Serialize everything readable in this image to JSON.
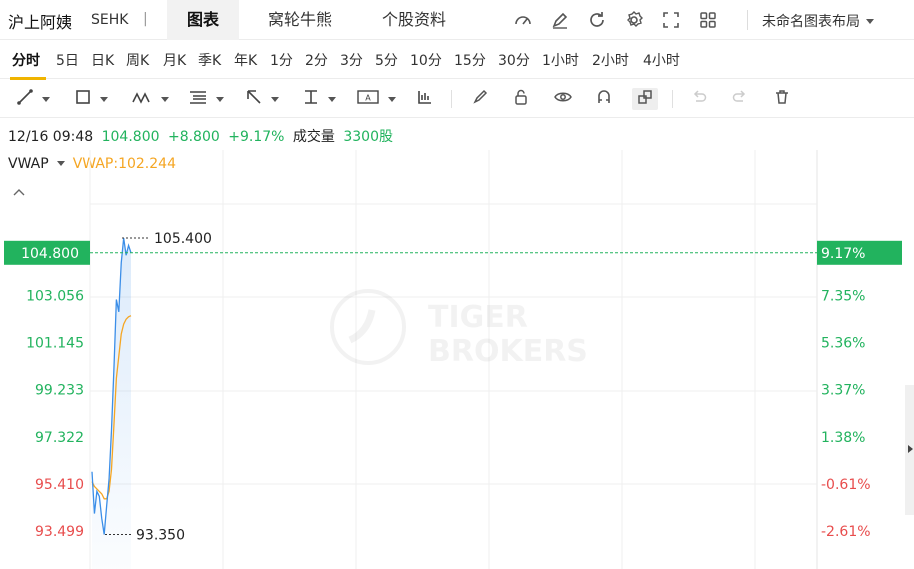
{
  "header": {
    "stock_name": "沪上阿姨",
    "stock_code": "SEHK",
    "separator": "|",
    "tabs": [
      {
        "label": "图表",
        "active": true
      },
      {
        "label": "窝轮牛熊",
        "active": false
      },
      {
        "label": "个股资料",
        "active": false
      }
    ],
    "icons": [
      "gauge-icon",
      "edit-icon",
      "refresh-icon",
      "settings-icon",
      "fullscreen-icon",
      "grid-icon"
    ],
    "layout_name": "未命名图表布局"
  },
  "periods": [
    "分时",
    "5日",
    "日K",
    "周K",
    "月K",
    "季K",
    "年K",
    "1分",
    "2分",
    "3分",
    "5分",
    "10分",
    "15分",
    "30分",
    "1小时",
    "2小时",
    "4小时"
  ],
  "active_period": "分时",
  "toolbar": {
    "tools": [
      "line-tool-icon",
      "rect-tool-icon",
      "wave-tool-icon",
      "fib-tool-icon",
      "arrow-tool-icon",
      "price-range-icon",
      "text-tool-icon",
      "indicator-icon",
      "brush-icon",
      "lock-icon",
      "eye-icon",
      "magnet-icon",
      "link-icon",
      "undo-icon",
      "redo-icon",
      "delete-icon"
    ]
  },
  "quote": {
    "datetime": "12/16 09:48",
    "price": "104.800",
    "change": "+8.800",
    "change_pct": "+9.17%",
    "volume_label": "成交量",
    "volume": "3300股"
  },
  "indicator": {
    "name": "VWAP",
    "value_label": "VWAP:102.244"
  },
  "chart_data": {
    "type": "line",
    "y_ticks": [
      "104.800",
      "103.056",
      "101.145",
      "99.233",
      "97.322",
      "95.410",
      "93.499"
    ],
    "y_tick_values": [
      104.8,
      103.056,
      101.145,
      99.233,
      97.322,
      95.41,
      93.499
    ],
    "pct_ticks": [
      "9.17%",
      "7.35%",
      "5.36%",
      "3.37%",
      "1.38%",
      "-0.61%",
      "-2.61%"
    ],
    "current_price": 104.8,
    "high_label": "105.400",
    "low_label": "93.350",
    "ylim": [
      92.6,
      107.5
    ],
    "series": [
      {
        "name": "price",
        "color": "#3b8ee8",
        "values": [
          95.9,
          94.2,
          95.1,
          94.9,
          94.0,
          93.35,
          94.5,
          95.6,
          97.6,
          100.1,
          102.9,
          102.4,
          104.4,
          105.4,
          104.7,
          105.1,
          104.8
        ]
      },
      {
        "name": "VWAP",
        "color": "#f5a623",
        "values": [
          95.5,
          95.3,
          95.2,
          95.1,
          95.0,
          94.8,
          94.8,
          95.1,
          96.0,
          97.8,
          99.7,
          100.6,
          101.5,
          101.9,
          102.1,
          102.2,
          102.244
        ]
      }
    ],
    "watermark": [
      "TIGER",
      "BROKERS"
    ],
    "grid": true
  }
}
